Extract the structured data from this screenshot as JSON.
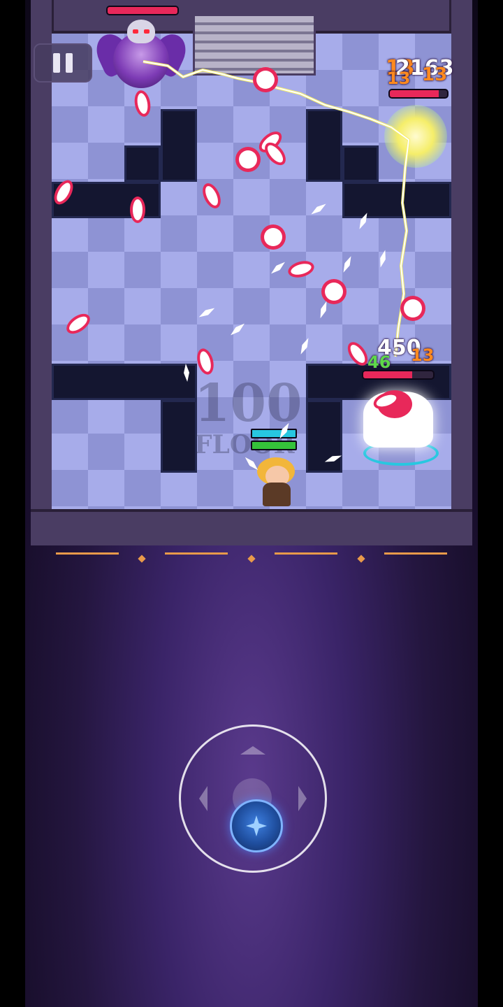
{
  "hud": {
    "score_top_right": "2163",
    "floor_watermark_number": "100",
    "floor_watermark_label": "FLOOR"
  },
  "damage_numbers": {
    "top_right_a": "13",
    "top_right_b": "13",
    "top_right_c": "13",
    "enemy_big": "450",
    "enemy_green": "46",
    "enemy_orange": "13"
  },
  "health": {
    "boss_hp_fraction": 1.0,
    "critter_hp_fraction": 0.85,
    "enemy_hp_fraction": 0.7,
    "hero_bar_top_fraction": 1.0,
    "hero_bar_bottom_fraction": 1.0
  },
  "controls": {
    "pause": "pause-icon",
    "joystick": "virtual-joystick"
  },
  "colors": {
    "hp_red": "#e8285a",
    "hero_bar_top": "#27c7e0",
    "hero_bar_bottom": "#35c23a",
    "lightning": "#f5ee6a",
    "damage_orange": "#ff8a1f",
    "damage_green": "#5ed84a",
    "background": "#24163f"
  }
}
